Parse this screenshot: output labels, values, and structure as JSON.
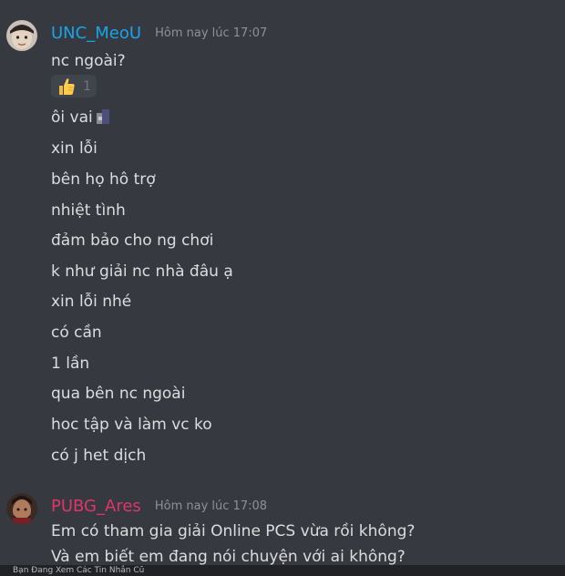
{
  "colors": {
    "background": "#36393f",
    "message_text": "#dcddde",
    "timestamp": "#8e9297",
    "reaction_bg": "#40444b",
    "user1_name": "#1aa3e8",
    "user2_name": "#e0356a",
    "bottom_bar": "#202225"
  },
  "messages": [
    {
      "username": "UNC_MeoU",
      "timestamp": "Hôm nay lúc 17:07",
      "avatar_icon": "avatar-icon",
      "first_line": "nc ngoài?",
      "reaction": {
        "emoji": "thumbs-up-icon",
        "count": "1"
      },
      "lines": [
        "ôi vai",
        "xin lỗi",
        "bên họ hô trợ",
        "nhiệt tình",
        "đảm bảo cho ng chơi",
        "k như giải nc nhà đâu ạ",
        "xin lỗi nhé",
        "có cần",
        "1 lần",
        "qua bên nc ngoài",
        "hoc tập và làm vc ko",
        "có j het dịch"
      ]
    },
    {
      "username": "PUBG_Ares",
      "timestamp": "Hôm nay lúc 17:08",
      "avatar_icon": "avatar-icon",
      "lines": [
        "Em có tham gia giải Online PCS vừa rồi không?",
        "Và em biết em đang nói chuyện với ai không?"
      ]
    }
  ],
  "bottom_bar": {
    "text": "Bạn Đang Xem Các Tin Nhắn Cũ"
  }
}
